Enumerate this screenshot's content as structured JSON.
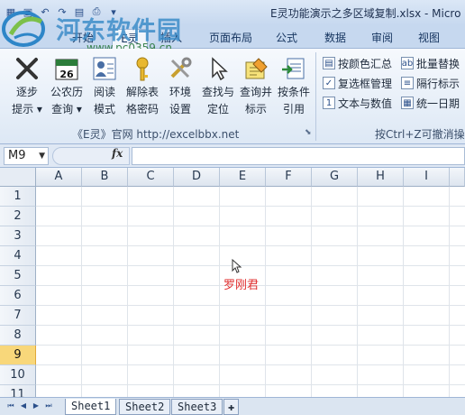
{
  "window": {
    "title": "E灵功能演示之多区域复制.xlsx - Micro"
  },
  "watermark": {
    "site_name": "河东软件园",
    "url": "www.pc0359.cn"
  },
  "tabs": [
    {
      "label": "开始"
    },
    {
      "label": "E灵"
    },
    {
      "label": "插入"
    },
    {
      "label": "页面布局"
    },
    {
      "label": "公式"
    },
    {
      "label": "数据"
    },
    {
      "label": "审阅"
    },
    {
      "label": "视图"
    }
  ],
  "ribbon": {
    "large_buttons": [
      {
        "line1": "逐步",
        "line2": "提示",
        "icon": "x-mark-icon",
        "dropdown": true
      },
      {
        "line1": "公农历",
        "line2": "查询",
        "icon": "calendar-icon",
        "day": "26",
        "dropdown": true
      },
      {
        "line1": "阅读",
        "line2": "模式",
        "icon": "reading-icon",
        "dropdown": false
      },
      {
        "line1": "解除表",
        "line2": "格密码",
        "icon": "key-icon",
        "dropdown": false
      },
      {
        "line1": "环境",
        "line2": "设置",
        "icon": "tools-icon",
        "dropdown": false
      },
      {
        "line1": "查找与",
        "line2": "定位",
        "icon": "cursor-icon",
        "dropdown": false
      },
      {
        "line1": "查询并",
        "line2": "标示",
        "icon": "highlighter-icon",
        "dropdown": false
      },
      {
        "line1": "按条件",
        "line2": "引用",
        "icon": "reference-icon",
        "dropdown": false
      }
    ],
    "group1_label": "《E灵》官网 http://excelbbx.net",
    "small_buttons_col1": [
      {
        "label": "按颜色汇总",
        "icon": "color-sum-icon"
      },
      {
        "label": "复选框管理",
        "icon": "checkbox-icon"
      },
      {
        "label": "文本与数值",
        "icon": "text-number-icon"
      }
    ],
    "small_buttons_col2": [
      {
        "label": "批量替换",
        "icon": "replace-icon"
      },
      {
        "label": "隔行标示",
        "icon": "row-mark-icon"
      },
      {
        "label": "统一日期",
        "icon": "date-icon"
      }
    ],
    "group2_label": "按Ctrl+Z可撤消操作"
  },
  "formula_bar": {
    "name_box": "M9",
    "fx_label": "fx",
    "formula": ""
  },
  "grid": {
    "columns": [
      "A",
      "B",
      "C",
      "D",
      "E",
      "F",
      "G",
      "H",
      "I"
    ],
    "rows": [
      "1",
      "2",
      "3",
      "4",
      "5",
      "6",
      "7",
      "8",
      "9",
      "10",
      "11"
    ],
    "selected_row": "9",
    "cell_text": "罗刚君"
  },
  "sheets": [
    {
      "label": "Sheet1",
      "active": true
    },
    {
      "label": "Sheet2",
      "active": false
    },
    {
      "label": "Sheet3",
      "active": false
    }
  ]
}
